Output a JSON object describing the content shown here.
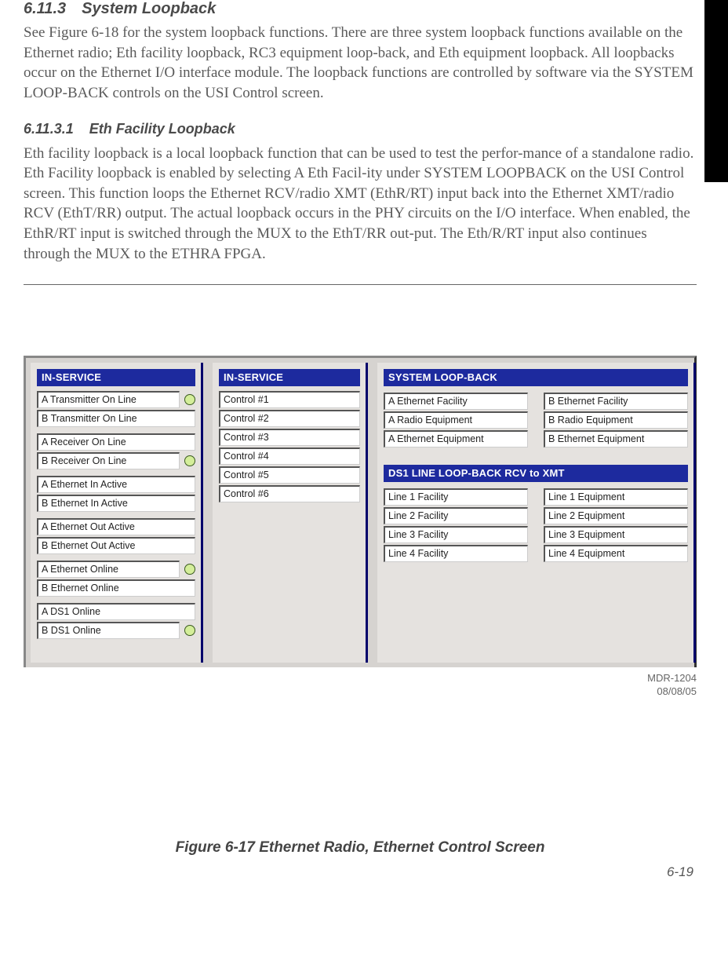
{
  "headings": {
    "h1_num": "6.11.3",
    "h1_title": "System Loopback",
    "h2_num": "6.11.3.1",
    "h2_title": "Eth Facility Loopback"
  },
  "paragraphs": {
    "p1": "See Figure 6-18 for the system loopback functions. There are three system loopback functions available on the Ethernet radio; Eth facility loopback, RC3 equipment loop-back, and Eth equipment loopback. All loopbacks occur on the Ethernet I/O interface module. The loopback functions are controlled by software via the SYSTEM LOOP-BACK controls on the USI Control screen.",
    "p2": "Eth facility loopback is a local loopback function that can be used to test the perfor-mance of a standalone radio. Eth Facility loopback is enabled by selecting A Eth Facil-ity under SYSTEM LOOPBACK on the USI Control screen. This function loops the Ethernet RCV/radio XMT (EthR/RT) input back into the Ethernet XMT/radio RCV (EthT/RR) output. The actual loopback occurs in the PHY circuits on the I/O interface. When enabled, the EthR/RT input is switched through the MUX to the EthT/RR out-put. The Eth/R/RT input also continues through the MUX to the ETHRA FPGA."
  },
  "ui": {
    "panel1_header": "IN-SERVICE",
    "panel1_items": {
      "a_tx": "A Transmitter On Line",
      "b_tx": "B Transmitter On Line",
      "a_rx": "A Receiver On Line",
      "b_rx": "B Receiver On Line",
      "a_eth_in": "A Ethernet In Active",
      "b_eth_in": "B Ethernet In Active",
      "a_eth_out": "A Ethernet Out Active",
      "b_eth_out": "B Ethernet Out Active",
      "a_eth_on": "A Ethernet Online",
      "b_eth_on": "B Ethernet Online",
      "a_ds1": "A DS1 Online",
      "b_ds1": "B DS1 Online"
    },
    "panel2_header": "IN-SERVICE",
    "panel2_items": {
      "c1": "Control #1",
      "c2": "Control #2",
      "c3": "Control #3",
      "c4": "Control #4",
      "c5": "Control #5",
      "c6": "Control #6"
    },
    "panel3_header1": "SYSTEM LOOP-BACK",
    "panel3_loop": {
      "a1": "A Ethernet Facility",
      "a2": "A Radio Equipment",
      "a3": "A Ethernet Equipment",
      "b1": "B Ethernet Facility",
      "b2": "B Radio Equipment",
      "b3": "B Ethernet Equipment"
    },
    "panel3_header2": "DS1 LINE LOOP-BACK RCV to XMT",
    "panel3_ds1": {
      "f1": "Line 1 Facility",
      "f2": "Line 2 Facility",
      "f3": "Line 3 Facility",
      "f4": "Line 4 Facility",
      "e1": "Line 1 Equipment",
      "e2": "Line 2 Equipment",
      "e3": "Line 3 Equipment",
      "e4": "Line 4 Equipment"
    }
  },
  "footer": {
    "doc_id": "MDR-1204",
    "doc_date": "08/08/05",
    "caption": "Figure 6-17  Ethernet Radio, Ethernet Control Screen",
    "page_num": "6-19"
  }
}
